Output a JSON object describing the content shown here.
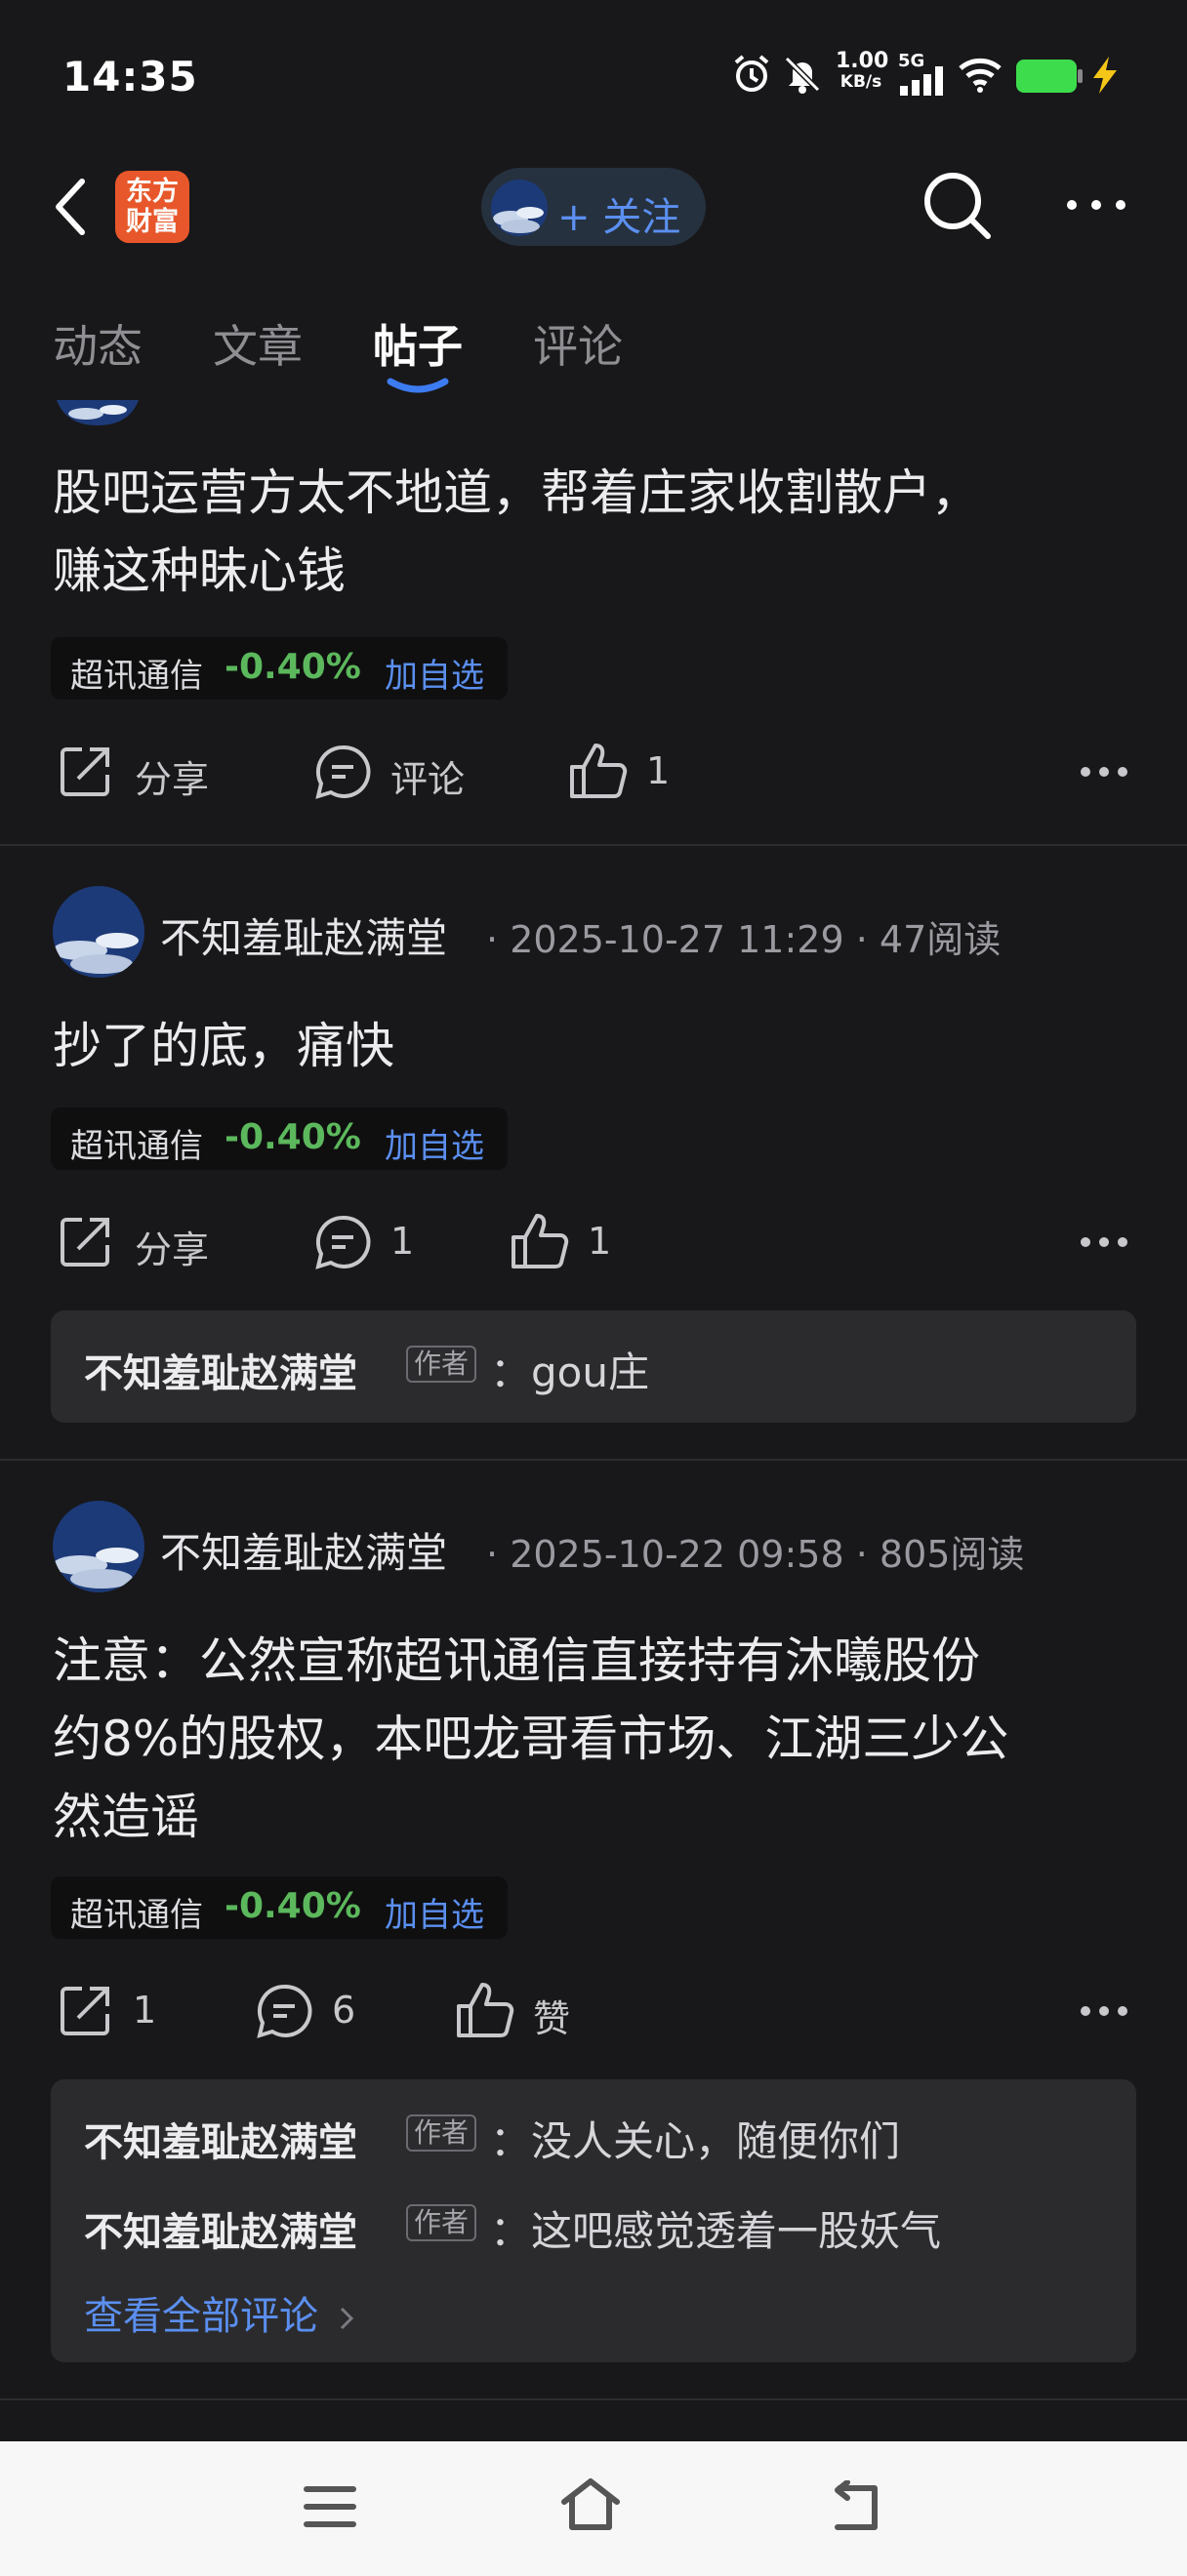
{
  "status_bar": {
    "time": "14:35",
    "network_speed_value": "1.00",
    "network_speed_unit": "KB/s",
    "network_type": "5G",
    "battery_color": "#3ddc4c",
    "icons": [
      "alarm-icon",
      "mute-icon",
      "signal-icon",
      "wifi-icon",
      "battery-icon",
      "charging-icon"
    ]
  },
  "header": {
    "logo_line1": "东方",
    "logo_line2": "财富",
    "follow_label": "+ 关注",
    "icons": [
      "back-icon",
      "search-icon",
      "more-icon"
    ]
  },
  "tabs": [
    {
      "label": "动态",
      "active": false
    },
    {
      "label": "文章",
      "active": false
    },
    {
      "label": "帖子",
      "active": true
    },
    {
      "label": "评论",
      "active": false
    }
  ],
  "posts": [
    {
      "text_line1": "股吧运营方太不地道，帮着庄家收割散户，",
      "text_line2": "赚这种昧心钱",
      "stock": {
        "name": "超讯通信",
        "change": "-0.40%",
        "add_label": "加自选"
      },
      "actions": {
        "share": "分享",
        "comment": "评论",
        "like": "1"
      }
    },
    {
      "author": "不知羞耻赵满堂",
      "date": "2025-10-27 11:29",
      "reads": "47阅读",
      "text_line1": "抄了的底，痛快",
      "stock": {
        "name": "超讯通信",
        "change": "-0.40%",
        "add_label": "加自选"
      },
      "actions": {
        "share": "分享",
        "comment": "1",
        "like": "1"
      },
      "comments": [
        {
          "author": "不知羞耻赵满堂",
          "badge": "作者",
          "text": "gou庄"
        }
      ]
    },
    {
      "author": "不知羞耻赵满堂",
      "date": "2025-10-22 09:58",
      "reads": "805阅读",
      "text_line1": "注意：公然宣称超讯通信直接持有沐曦股份",
      "text_line2": "约8%的股权，本吧龙哥看市场、江湖三少公",
      "text_line3": "然造谣",
      "stock": {
        "name": "超讯通信",
        "change": "-0.40%",
        "add_label": "加自选"
      },
      "actions": {
        "share": "1",
        "comment": "6",
        "like": "赞"
      },
      "comments": [
        {
          "author": "不知羞耻赵满堂",
          "badge": "作者",
          "text": "没人关心，随便你们"
        },
        {
          "author": "不知羞耻赵满堂",
          "badge": "作者",
          "text": "这吧感觉透着一股妖气"
        }
      ],
      "view_all": "查看全部评论"
    }
  ],
  "meta_separator": "·",
  "comment_separator": "：",
  "navbar_icons": [
    "menu-icon",
    "home-icon",
    "back-nav-icon"
  ],
  "colors": {
    "accent": "#5b8ff0",
    "down_green": "#5cb85c",
    "brand_orange": "#e8572b"
  }
}
